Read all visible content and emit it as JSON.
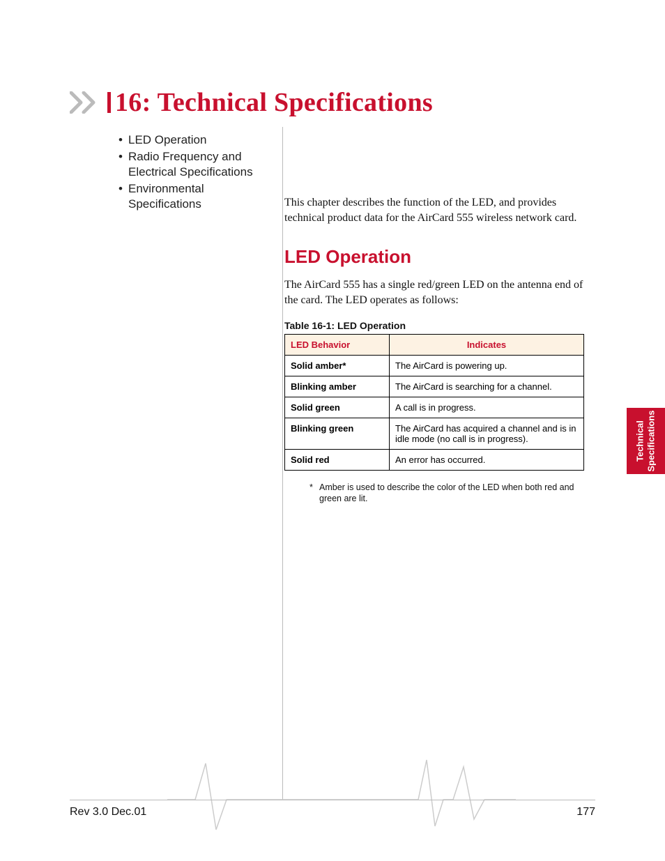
{
  "chapter": {
    "title": "16: Technical Specifications"
  },
  "toc": {
    "items": [
      {
        "label": "LED Operation"
      },
      {
        "label": "Radio Frequency and Electrical Specifications"
      },
      {
        "label": "Environmental Specifications"
      }
    ]
  },
  "intro": "This chapter describes the function of the LED, and provides technical product data for the AirCard 555 wireless network card.",
  "section": {
    "title": "LED Operation",
    "body": "The AirCard 555 has a single red/green LED on the antenna end of the card. The LED operates as follows:"
  },
  "table": {
    "caption": "Table 16-1: LED Operation",
    "headers": [
      "LED Behavior",
      "Indicates"
    ],
    "rows": [
      {
        "behavior": "Solid amber*",
        "indicates": "The AirCard is powering up."
      },
      {
        "behavior": "Blinking amber",
        "indicates": "The AirCard is searching for a channel."
      },
      {
        "behavior": "Solid green",
        "indicates": "A call is in progress."
      },
      {
        "behavior": "Blinking green",
        "indicates": "The AirCard has acquired a channel and is in idle mode (no call is in progress)."
      },
      {
        "behavior": "Solid red",
        "indicates": "An error has occurred."
      }
    ]
  },
  "footnote": {
    "marker": "*",
    "text": "Amber is used to describe the color of the LED when both red and green are lit."
  },
  "sidetab": {
    "line1": "Technical",
    "line2": "Specifications"
  },
  "footer": {
    "left": "Rev 3.0  Dec.01",
    "right": "177"
  }
}
